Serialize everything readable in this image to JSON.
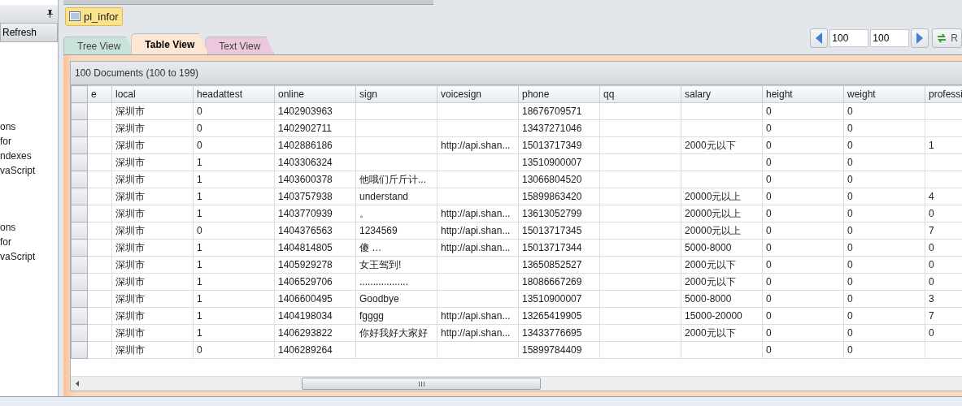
{
  "sidebar": {
    "refresh_label": "Refresh",
    "groups": [
      {
        "items": [
          "ons",
          "for",
          "ndexes",
          "vaScript"
        ]
      },
      {
        "items": [
          "ons",
          "for",
          "vaScript"
        ]
      }
    ]
  },
  "collection_tag": "pl_infor",
  "tabs": [
    {
      "label": "Tree View",
      "selected": false,
      "color": "#c9e3da"
    },
    {
      "label": "Table View",
      "selected": true,
      "color": "#fde6d4"
    },
    {
      "label": "Text View",
      "selected": false,
      "color": "#ecc8dc"
    }
  ],
  "pager": {
    "skip": "100",
    "limit": "100",
    "refresh_label": "R"
  },
  "table": {
    "summary": "100 Documents (100 to 199)",
    "columns": [
      "e",
      "local",
      "headattest",
      "online",
      "sign",
      "voicesign",
      "phone",
      "qq",
      "salary",
      "height",
      "weight",
      "professi"
    ],
    "rows": [
      [
        null,
        "深圳市",
        "0",
        "1402903963",
        null,
        null,
        "18676709571",
        null,
        null,
        "0",
        "0",
        null
      ],
      [
        null,
        "深圳市",
        "0",
        "1402902711",
        null,
        null,
        "13437271046",
        null,
        null,
        "0",
        "0",
        null
      ],
      [
        null,
        "深圳市",
        "0",
        "1402886186",
        null,
        "http://api.shan...",
        "15013717349",
        null,
        "2000元以下",
        "0",
        "0",
        "1"
      ],
      [
        null,
        "深圳市",
        "1",
        "1403306324",
        null,
        null,
        "13510900007",
        null,
        null,
        "0",
        "0",
        null
      ],
      [
        null,
        "深圳市",
        "1",
        "1403600378",
        "他哦们斤斤计...",
        null,
        "13066804520",
        null,
        null,
        "0",
        "0",
        null
      ],
      [
        null,
        "深圳市",
        "1",
        "1403757938",
        "understand",
        null,
        "15899863420",
        null,
        "20000元以上",
        "0",
        "0",
        "4"
      ],
      [
        null,
        "深圳市",
        "1",
        "1403770939",
        "。",
        "http://api.shan...",
        "13613052799",
        null,
        "20000元以上",
        "0",
        "0",
        "0"
      ],
      [
        null,
        "深圳市",
        "0",
        "1404376563",
        "1234569",
        "http://api.shan...",
        "15013717345",
        null,
        "20000元以上",
        "0",
        "0",
        "7"
      ],
      [
        null,
        "深圳市",
        "1",
        "1404814805",
        "傻 …",
        "http://api.shan...",
        "15013717344",
        null,
        "5000-8000",
        "0",
        "0",
        "0"
      ],
      [
        null,
        "深圳市",
        "1",
        "1405929278",
        "女王驾到!",
        null,
        "13650852527",
        null,
        "2000元以下",
        "0",
        "0",
        "0"
      ],
      [
        null,
        "深圳市",
        "1",
        "1406529706",
        "..................",
        null,
        "18086667269",
        null,
        "2000元以下",
        "0",
        "0",
        "0"
      ],
      [
        null,
        "深圳市",
        "1",
        "1406600495",
        "Goodbye",
        null,
        "13510900007",
        null,
        "5000-8000",
        "0",
        "0",
        "3"
      ],
      [
        null,
        "深圳市",
        "1",
        "1404198034",
        "fgggg",
        "http://api.shan...",
        "13265419905",
        null,
        "15000-20000",
        "0",
        "0",
        "7"
      ],
      [
        null,
        "深圳市",
        "1",
        "1406293822",
        "你好我好大家好",
        "http://api.shan...",
        "13433776695",
        null,
        "2000元以下",
        "0",
        "0",
        "0"
      ],
      [
        null,
        "深圳市",
        "0",
        "1406289264",
        null,
        null,
        "15899784409",
        null,
        null,
        "0",
        "0",
        null
      ]
    ]
  }
}
